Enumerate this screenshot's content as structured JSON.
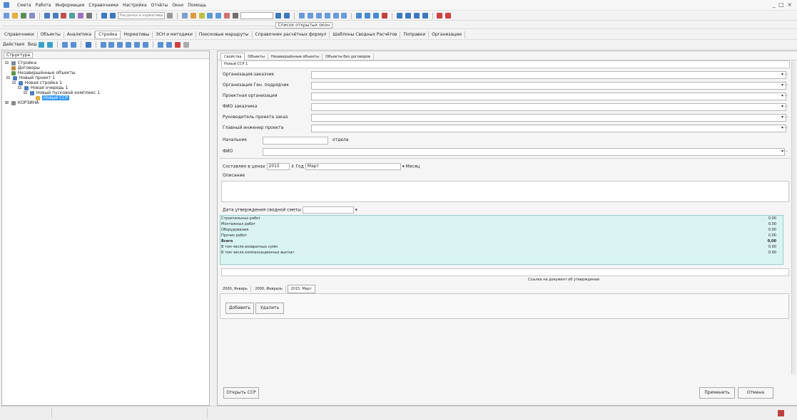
{
  "window": {
    "menu": [
      "Смета",
      "Работа",
      "Информация",
      "Справочники",
      "Настройка",
      "Отчёты",
      "Окно",
      "Помощь"
    ],
    "controls": "_ □ ×"
  },
  "toolbar": {
    "combo_placeholder": "Расценки и нормативы",
    "open_list_label": "Список открытых окон"
  },
  "tabs_main": [
    "Справочники",
    "Объекты",
    "Аналитика",
    "Стройка",
    "Нормативы",
    "ЭСН и методики",
    "Поисковые маршруты",
    "Справочник расчётных формул",
    "Шаблоны Сводных Расчётов",
    "Поправки",
    "Организации"
  ],
  "actions_bar": {
    "actions_label": "Действия",
    "view_label": "Вид"
  },
  "left": {
    "panel_label": "Структура",
    "tree": [
      {
        "label": "Стройка",
        "level": 0
      },
      {
        "label": "Договоры",
        "level": 1
      },
      {
        "label": "Незавершённые объекты",
        "level": 1
      },
      {
        "label": "Новый проект 1",
        "level": 1
      },
      {
        "label": "Новая стройка 1",
        "level": 2
      },
      {
        "label": "Новая очередь 1",
        "level": 3
      },
      {
        "label": "Новый пусковой комплекс 1",
        "level": 4
      },
      {
        "label": "Новый ССР",
        "level": 5,
        "selected": true
      },
      {
        "label": "КОРЗИНА",
        "level": 0
      }
    ]
  },
  "right": {
    "tabs": [
      "Свойства",
      "Объекты",
      "Незавершённые объекты",
      "Объекты без договоров"
    ],
    "name_value": "Новый ССР 1",
    "fields": [
      "Организация-заказчик",
      "Организация Ген. подрядчик",
      "Проектная организация",
      "ФИО заказчика",
      "Руководитель проекта заказ",
      "Главный инженер проекта"
    ],
    "nachalnik_label": "Начальник",
    "otdela_label": "отдела",
    "fio_label": "ФИО",
    "composed_label": "Составлен в ценах",
    "year_value": "2015",
    "year_suffix": "Год",
    "month_value": "Март",
    "month_suffix": "Месяц",
    "description_label": "Описание",
    "approval_label": "Дата утверждения сводной сметы",
    "summary": [
      {
        "label": "Строительных работ",
        "value": "0.00",
        "bold": false
      },
      {
        "label": "Монтажных работ",
        "value": "0.00",
        "bold": false
      },
      {
        "label": "Оборудования",
        "value": "0.00",
        "bold": false
      },
      {
        "label": "Прочих работ",
        "value": "0.00",
        "bold": false
      },
      {
        "label": "Всего",
        "value": "0,00",
        "bold": true
      },
      {
        "label": "В том числе возвратных сумм",
        "value": "0.00",
        "bold": false
      },
      {
        "label": "В том числе компенсационных выплат",
        "value": "0.00",
        "bold": false
      }
    ],
    "approval_link": "Ссылка на документ об утверждении",
    "bottom_tabs": [
      "2000, Январь",
      "2000, Февраль",
      "2015, Март"
    ],
    "add_button": "Добавить",
    "delete_button": "Удалить",
    "open_button": "Открыть ССР",
    "apply_button": "Применить",
    "cancel_button": "Отмена"
  }
}
